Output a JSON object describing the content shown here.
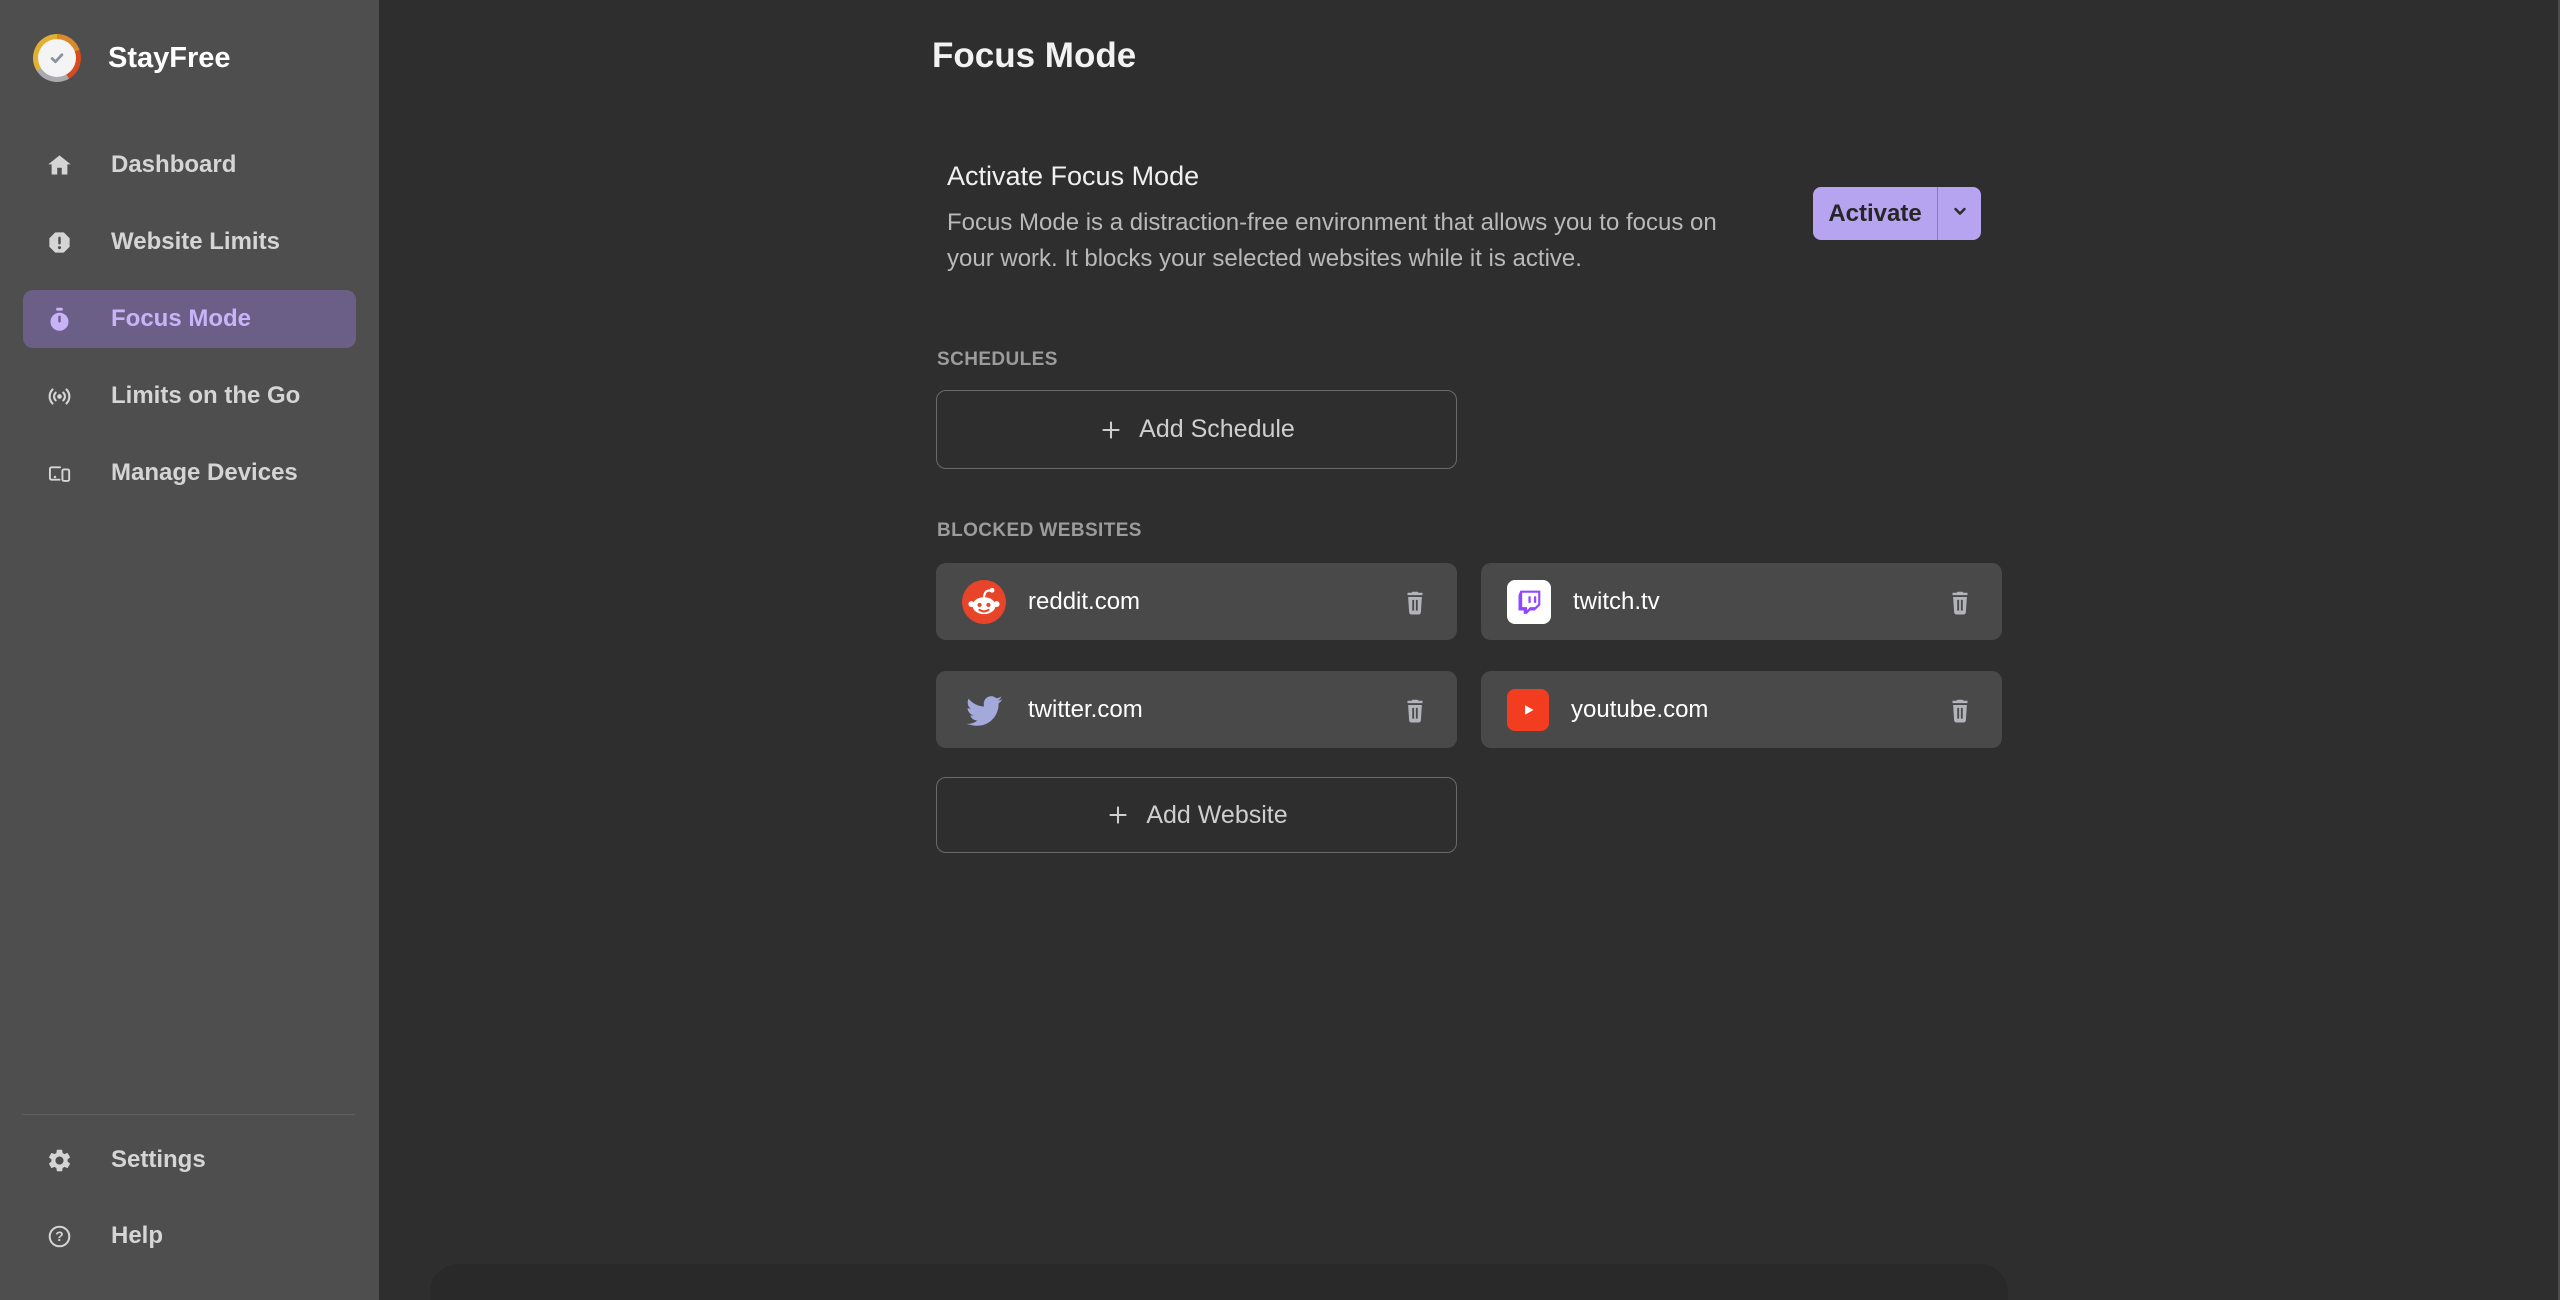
{
  "app": {
    "title": "StayFree"
  },
  "colors": {
    "sidebar_bg": "#4f4e4e",
    "main_bg": "#2f2e2e",
    "card_bg": "#4a4949",
    "accent_purple": "#b7a4f1",
    "active_item_bg": "#6c5f87",
    "active_item_text": "#c9b3f8",
    "reddit": "#e8442a",
    "twitch": "#9146ff",
    "twitter_bird": "#a3a9db",
    "youtube": "#f23d20"
  },
  "sidebar": {
    "items": [
      {
        "label": "Dashboard",
        "icon": "home-icon",
        "active": false
      },
      {
        "label": "Website Limits",
        "icon": "alert-octagon-icon",
        "active": false
      },
      {
        "label": "Focus Mode",
        "icon": "stopwatch-icon",
        "active": true
      },
      {
        "label": "Limits on the Go",
        "icon": "broadcast-icon",
        "active": false
      },
      {
        "label": "Manage Devices",
        "icon": "devices-icon",
        "active": false
      }
    ],
    "footer_items": [
      {
        "label": "Settings",
        "icon": "gear-icon"
      },
      {
        "label": "Help",
        "icon": "help-circle-icon"
      }
    ]
  },
  "main": {
    "title": "Focus Mode",
    "activate": {
      "heading": "Activate Focus Mode",
      "description_lines": [
        "Focus Mode is a distraction-free environment that allows you to focus on",
        "your work. It blocks your selected websites while it is active."
      ],
      "button_label": "Activate"
    },
    "schedules": {
      "label": "SCHEDULES",
      "add_button_label": "Add Schedule"
    },
    "blocked_websites": {
      "label": "BLOCKED WEBSITES",
      "sites": [
        {
          "name": "reddit.com",
          "icon": "reddit-icon"
        },
        {
          "name": "twitch.tv",
          "icon": "twitch-icon"
        },
        {
          "name": "twitter.com",
          "icon": "twitter-icon"
        },
        {
          "name": "youtube.com",
          "icon": "youtube-icon"
        }
      ],
      "add_button_label": "Add Website"
    }
  }
}
